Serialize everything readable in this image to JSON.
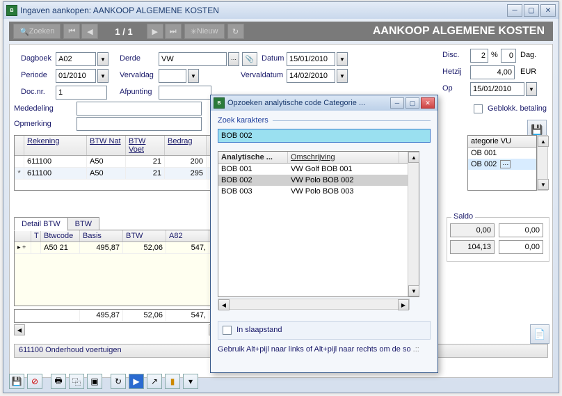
{
  "main": {
    "title": "Ingaven aankopen:  AANKOOP ALGEMENE KOSTEN",
    "banner": {
      "search": "Zoeken",
      "counter": "1 / 1",
      "nieuw": "Nieuw",
      "heading": "AANKOOP ALGEMENE KOSTEN"
    }
  },
  "fields": {
    "dagboek_lbl": "Dagboek",
    "dagboek": "A02",
    "periode_lbl": "Periode",
    "periode": "01/2010",
    "docnr_lbl": "Doc.nr.",
    "docnr": "1",
    "derde_lbl": "Derde",
    "derde": "VW",
    "vervaldag_lbl": "Vervaldag",
    "afpunting_lbl": "Afpunting",
    "datum_lbl": "Datum",
    "datum": "15/01/2010",
    "vervaldatum_lbl": "Vervaldatum",
    "vervaldatum": "14/02/2010",
    "disc_lbl": "Disc.",
    "disc_pct": "2",
    "disc_pct_unit": "%",
    "disc_days": "0",
    "disc_days_unit": "Dag.",
    "hetzij_lbl": "Hetzij",
    "hetzij": "4,00",
    "hetzij_cur": "EUR",
    "op_lbl": "Op",
    "op": "15/01/2010",
    "mededeling_lbl": "Mededeling",
    "opmerking_lbl": "Opmerking",
    "geblokk_lbl": "Geblokk. betaling"
  },
  "grid1": {
    "h_rek": "Rekening",
    "h_btwnat": "BTW Nat",
    "h_btwvoet": "BTW Voet",
    "h_bedrag": "Bedrag",
    "rows": [
      {
        "marker": "",
        "rek": "611100",
        "nat": "A50",
        "voet": "21",
        "bed": "200"
      },
      {
        "marker": "*",
        "rek": "611100",
        "nat": "A50",
        "voet": "21",
        "bed": "295"
      }
    ]
  },
  "tabs": {
    "t1": "Detail BTW",
    "t2": "BTW"
  },
  "grid2": {
    "h_t": "T",
    "h_code": "Btwcode",
    "h_basis": "Basis",
    "h_btw": "BTW",
    "h_a82": "A82",
    "row": {
      "marker": "▸ +",
      "t": "",
      "code": "A50 21",
      "basis": "495,87",
      "btw": "52,06",
      "a82": "547,"
    },
    "totals": {
      "basis": "495,87",
      "btw": "52,06",
      "a82": "547,"
    }
  },
  "status": "611100 Onderhoud voertuigen",
  "category_panel": {
    "header": "ategorie VU",
    "rows": [
      "OB 001",
      "OB 002"
    ]
  },
  "saldo": {
    "label": "Saldo",
    "a1": "0,00",
    "a2": "0,00",
    "b1": "104,13",
    "b2": "0,00"
  },
  "modal": {
    "title": "Opzoeken analytische code Categorie ...",
    "search_label": "Zoek karakters",
    "search_value": "BOB 002",
    "h1": "Analytische ...",
    "h2": "Omschrijving",
    "rows": [
      {
        "c": "BOB 001",
        "d": "VW Golf BOB 001"
      },
      {
        "c": "BOB 002",
        "d": "VW Polo BOB 002"
      },
      {
        "c": "BOB 003",
        "d": "VW Polo BOB 003"
      }
    ],
    "sleep_label": "In slaapstand",
    "hint": "Gebruik Alt+pijl naar links of Alt+pijl naar rechts om de so"
  }
}
